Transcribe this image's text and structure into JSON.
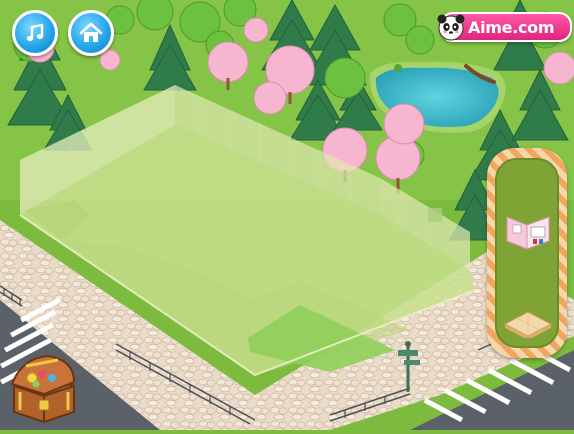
{
  "toolbar": {
    "music_icon": "music-note-icon",
    "home_icon": "home-icon"
  },
  "brand": {
    "logo_text": "Aime.com",
    "logo_icon": "panda-icon"
  },
  "side_panel": {
    "items": [
      {
        "icon": "wall-furniture-icon"
      },
      {
        "icon": "floor-tile-icon"
      }
    ]
  },
  "inventory": {
    "icon": "treasure-chest-icon"
  },
  "colors": {
    "grass": "#7dbb3f",
    "pavement": "#e8d8c8",
    "road": "#5b6168",
    "lot": "#c7e08f",
    "accent_pink": "#e0247d",
    "button_blue": "#26a7e8"
  }
}
